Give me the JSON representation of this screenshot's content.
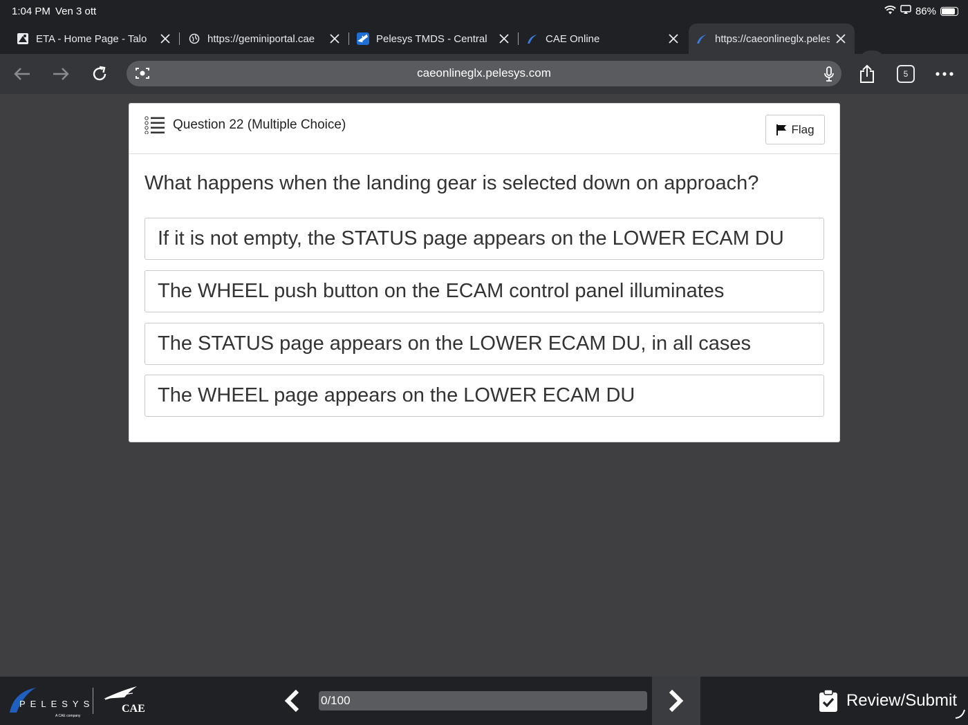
{
  "status_bar": {
    "time": "1:04 PM",
    "date": "Ven 3 ott",
    "battery": "86%",
    "battery_level": 0.86
  },
  "tabs": [
    {
      "title": "ETA - Home Page - Talon",
      "icon": "eta-favicon",
      "active": false
    },
    {
      "title": "https://geminiportal.cae",
      "icon": "globe-icon",
      "active": false
    },
    {
      "title": "Pelesys TMDS - Central",
      "icon": "plane-icon",
      "active": false
    },
    {
      "title": "CAE Online",
      "icon": "pelesys-favicon",
      "active": false
    },
    {
      "title": "https://caeonlineglx.pelesys",
      "icon": "pelesys-favicon",
      "active": true
    }
  ],
  "toolbar": {
    "url": "caeonlineglx.pelesys.com",
    "tab_count": "5"
  },
  "quiz": {
    "question_header": "Question 22 (Multiple Choice)",
    "flag_label": "Flag",
    "question_text": "What happens when the landing gear is selected down on approach?",
    "answers": [
      "If it is not empty, the STATUS page appears on the LOWER ECAM DU",
      "The WHEEL push button on the ECAM control panel illuminates",
      "The STATUS page appears on the LOWER ECAM DU, in all cases",
      "The WHEEL page appears on the LOWER ECAM DU"
    ]
  },
  "footer": {
    "brand": "PELESYS",
    "brand_sub": "A CAE company",
    "partner": "CAE",
    "progress_label": "0/100",
    "progress_value": 0,
    "review_label": "Review/Submit"
  },
  "colors": {
    "page_bg": "#3f3f41",
    "chrome_bg": "#202124",
    "toolbar_bg": "#35363a",
    "brand_blue": "#1f5fbf"
  }
}
